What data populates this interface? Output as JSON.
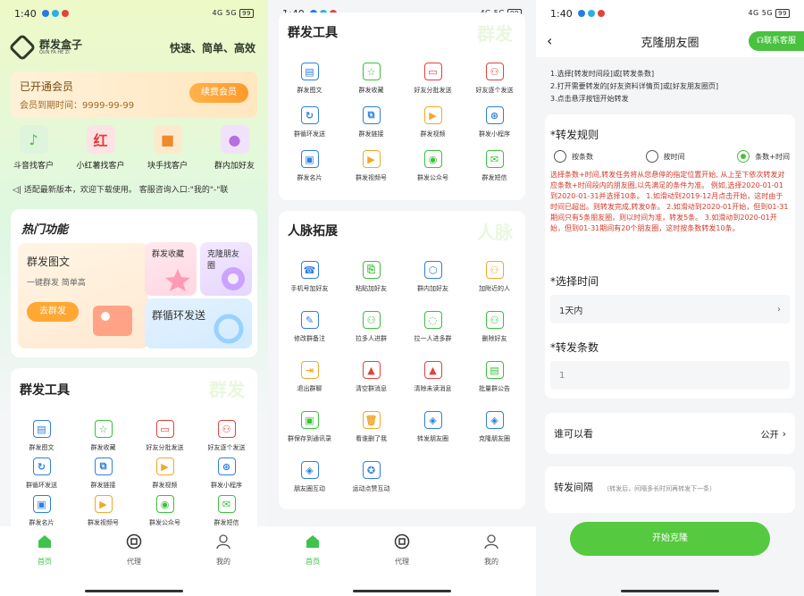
{
  "status": {
    "time": "1:40",
    "net": "4G 5G",
    "battery": "99"
  },
  "home": {
    "brand_name": "群发盒子",
    "brand_sub": "QUN FA HE ZI",
    "slogan": "快速、简单、高效",
    "vip_title": "已开通会员",
    "vip_expiry": "会员到期时间：9999-99-99",
    "vip_button": "续费会员",
    "quick": [
      {
        "label": "斗音找客户",
        "icon": "music-note-icon",
        "glyph": "♪",
        "color": "#4cc24a",
        "bg": "#dff4dd"
      },
      {
        "label": "小红薯找客户",
        "icon": "red-book-icon",
        "glyph": "红",
        "color": "#e33c3c",
        "bg": "#fde3e3"
      },
      {
        "label": "块手找客户",
        "icon": "video-camera-icon",
        "glyph": "■",
        "color": "#f08a2a",
        "bg": "#fdeacc"
      },
      {
        "label": "群内加好友",
        "icon": "add-user-icon",
        "glyph": "●",
        "color": "#b56fe0",
        "bg": "#f1e2fb"
      }
    ],
    "notice": "适配最新版本，欢迎下载使用。 客服咨询入口:\"我的\"-\"联",
    "hot_title": "热门功能",
    "hot_big_title": "群发图文",
    "hot_big_sub": "一键群发 简单高",
    "hot_big_btn": "去群发",
    "hot_a": "群发收藏",
    "hot_b": "克隆朋友圈",
    "hot_c": "群循环发送",
    "tools_title": "群发工具",
    "tools_wm": "群发"
  },
  "tools": [
    {
      "label": "群发图文",
      "icon": "image-text-icon",
      "glyph": "▤",
      "color": "#2f7fe0"
    },
    {
      "label": "群发收藏",
      "icon": "star-icon",
      "glyph": "☆",
      "color": "#3cbf3c"
    },
    {
      "label": "好友分批发送",
      "icon": "batch-send-icon",
      "glyph": "▭",
      "color": "#e0443a"
    },
    {
      "label": "好友逐个发送",
      "icon": "person-icon",
      "glyph": "⚇",
      "color": "#e0443a"
    },
    {
      "label": "群循环发送",
      "icon": "loop-icon",
      "glyph": "↻",
      "color": "#2f7fe0"
    },
    {
      "label": "群发链接",
      "icon": "link-icon",
      "glyph": "⧉",
      "color": "#2f7fe0"
    },
    {
      "label": "群发视频",
      "icon": "tv-icon",
      "glyph": "▶",
      "color": "#f0a82a"
    },
    {
      "label": "群发小程序",
      "icon": "mini-program-icon",
      "glyph": "⊛",
      "color": "#2f7fe0"
    },
    {
      "label": "群发名片",
      "icon": "card-icon",
      "glyph": "▣",
      "color": "#2f7fe0"
    },
    {
      "label": "群发视频号",
      "icon": "video-channel-icon",
      "glyph": "▶",
      "color": "#f0a82a"
    },
    {
      "label": "群发公众号",
      "icon": "official-account-icon",
      "glyph": "◉",
      "color": "#3cbf3c"
    },
    {
      "label": "群发短信",
      "icon": "sms-icon",
      "glyph": "✉",
      "color": "#3cbf3c"
    }
  ],
  "contacts_title": "人脉拓展",
  "contacts_wm": "人脉",
  "contacts": [
    {
      "label": "手机号加好友",
      "icon": "phone-add-icon",
      "glyph": "☎",
      "color": "#2f7fe0"
    },
    {
      "label": "粘贴加好友",
      "icon": "paste-add-icon",
      "glyph": "⎘",
      "color": "#3cbf3c"
    },
    {
      "label": "群内加好友",
      "icon": "group-add-icon",
      "glyph": "⬡",
      "color": "#2f7fe0"
    },
    {
      "label": "加附近的人",
      "icon": "nearby-icon",
      "glyph": "⚇",
      "color": "#f0a82a"
    },
    {
      "label": "修改群备注",
      "icon": "edit-icon",
      "glyph": "✎",
      "color": "#2f7fe0"
    },
    {
      "label": "拉多人进群",
      "icon": "multi-user-icon",
      "glyph": "⚇",
      "color": "#3cbf3c"
    },
    {
      "label": "拉一人进多群",
      "icon": "chat-icon",
      "glyph": "◌",
      "color": "#3cbf3c"
    },
    {
      "label": "删除好友",
      "icon": "delete-user-icon",
      "glyph": "⚇",
      "color": "#3cbf3c"
    },
    {
      "label": "退出群聊",
      "icon": "exit-icon",
      "glyph": "⇥",
      "color": "#f0a82a"
    },
    {
      "label": "清空群消息",
      "icon": "clear-icon",
      "glyph": "▲",
      "color": "#e0443a"
    },
    {
      "label": "清除未读消息",
      "icon": "unread-icon",
      "glyph": "▲",
      "color": "#e0443a"
    },
    {
      "label": "批量群公告",
      "icon": "announce-icon",
      "glyph": "▤",
      "color": "#3cbf3c"
    },
    {
      "label": "群保存到通讯录",
      "icon": "save-contact-icon",
      "glyph": "▣",
      "color": "#3cbf3c"
    },
    {
      "label": "看谁删了我",
      "icon": "trash-icon",
      "glyph": "🗑",
      "color": "#f0a82a"
    },
    {
      "label": "转发朋友圈",
      "icon": "moments-icon",
      "glyph": "◈",
      "color": "#2f7fe0"
    },
    {
      "label": "克隆朋友圈",
      "icon": "clone-moments-icon",
      "glyph": "◈",
      "color": "#2f7fe0"
    },
    {
      "label": "朋友圈互动",
      "icon": "moments-like-icon",
      "glyph": "◈",
      "color": "#2f7fe0"
    },
    {
      "label": "运动点赞互动",
      "icon": "run-icon",
      "glyph": "✪",
      "color": "#2f7fe0"
    }
  ],
  "tabbar": {
    "home": "首页",
    "agent": "代理",
    "mine": "我的"
  },
  "clone": {
    "title": "克隆朋友圈",
    "support_btn": "联系客服",
    "steps": [
      "1.选择[转发时间段]或[转发条数]",
      "2.打开需要转发的[好友资料详情页]或[好友朋友圈页]",
      "3.点击悬浮按钮开始转发"
    ],
    "rule_title": "*转发规则",
    "opt_count": "按条数",
    "opt_time": "按时间",
    "opt_both": "条数+时间",
    "warn": "选择条数+时间,转发任务将从您悬停的指定位置开始, 从上至下依次转发对应条数+时间段内的朋友圈,以先满足的条件为准。 例如,选择2020-01-01到2020-01-31并选择10条。 1.如滑动到2019-12月点击开始，这时由于时间已超出。则转发完成,转发0条。 2.如滑动到2020-01开始，但到01-31期间只有5条朋友圈，则以时间为准，转发5条。 3.如滑动到2020-01开始，但到01-31期间有20个朋友圈，这时按条数转发10条。",
    "time_title": "*选择时间",
    "time_value": "1天内",
    "count_title": "*转发条数",
    "count_value": "1",
    "who_label": "谁可以看",
    "who_value": "公开",
    "interval_title": "转发间隔",
    "interval_hint": "（转发后，间隔多长时间再转发下一条）",
    "start_btn": "开始克隆"
  },
  "colors": {
    "accent": "#4bbf3a",
    "warn": "#d23a2a",
    "orange": "#ffa733"
  }
}
